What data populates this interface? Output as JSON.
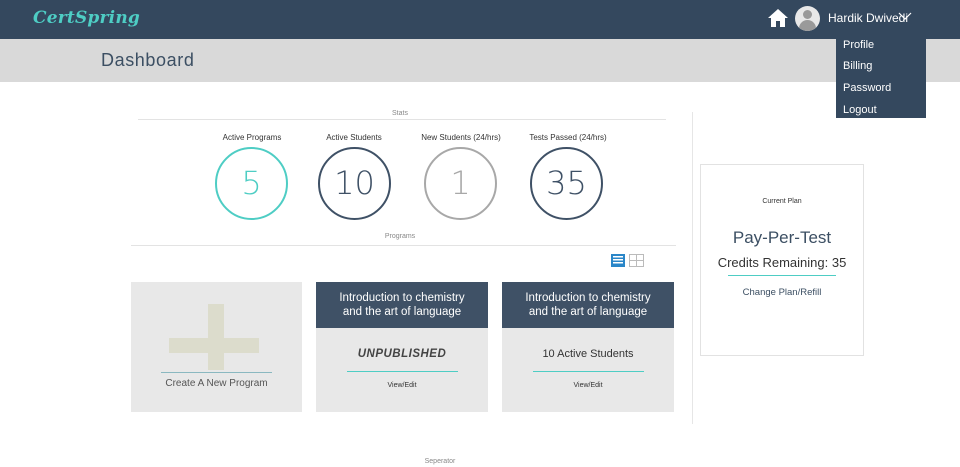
{
  "app": {
    "brand": "CertSpring"
  },
  "user": {
    "name": "Hardik Dwivedi"
  },
  "user_menu": {
    "items": [
      "Profile",
      "Billing",
      "Password",
      "Logout"
    ]
  },
  "page": {
    "title": "Dashboard"
  },
  "stats": {
    "title": "Stats",
    "items": [
      {
        "label": "Active Programs",
        "value": "5",
        "color": "#4ecdc4"
      },
      {
        "label": "Active Students",
        "value": "10",
        "color": "#3f5166"
      },
      {
        "label": "New Students (24/hrs)",
        "value": "1",
        "color": "#a8a8a8"
      },
      {
        "label": "Tests Passed (24/hrs)",
        "value": "35",
        "color": "#3f5166"
      }
    ]
  },
  "programs": {
    "title": "Programs",
    "view_icons": [
      "list-view-icon",
      "grid-view-icon"
    ],
    "create_label": "Create A New Program",
    "cards": [
      {
        "title_line1": "Introduction to chemistry",
        "title_line2": "and the art of language",
        "status": "UNPUBLISHED",
        "action": "View/Edit"
      },
      {
        "title_line1": "Introduction to chemistry",
        "title_line2": "and the art of language",
        "status": "10 Active Students",
        "action": "View/Edit"
      }
    ]
  },
  "plan": {
    "label": "Current Plan",
    "name": "Pay-Per-Test",
    "credits": "Credits Remaining: 35",
    "action": "Change Plan/Refill"
  },
  "footer": {
    "separator": "Seperator"
  },
  "colors": {
    "nav": "#34485e",
    "accent": "#4ecdc4",
    "card_header": "#3f5166"
  }
}
